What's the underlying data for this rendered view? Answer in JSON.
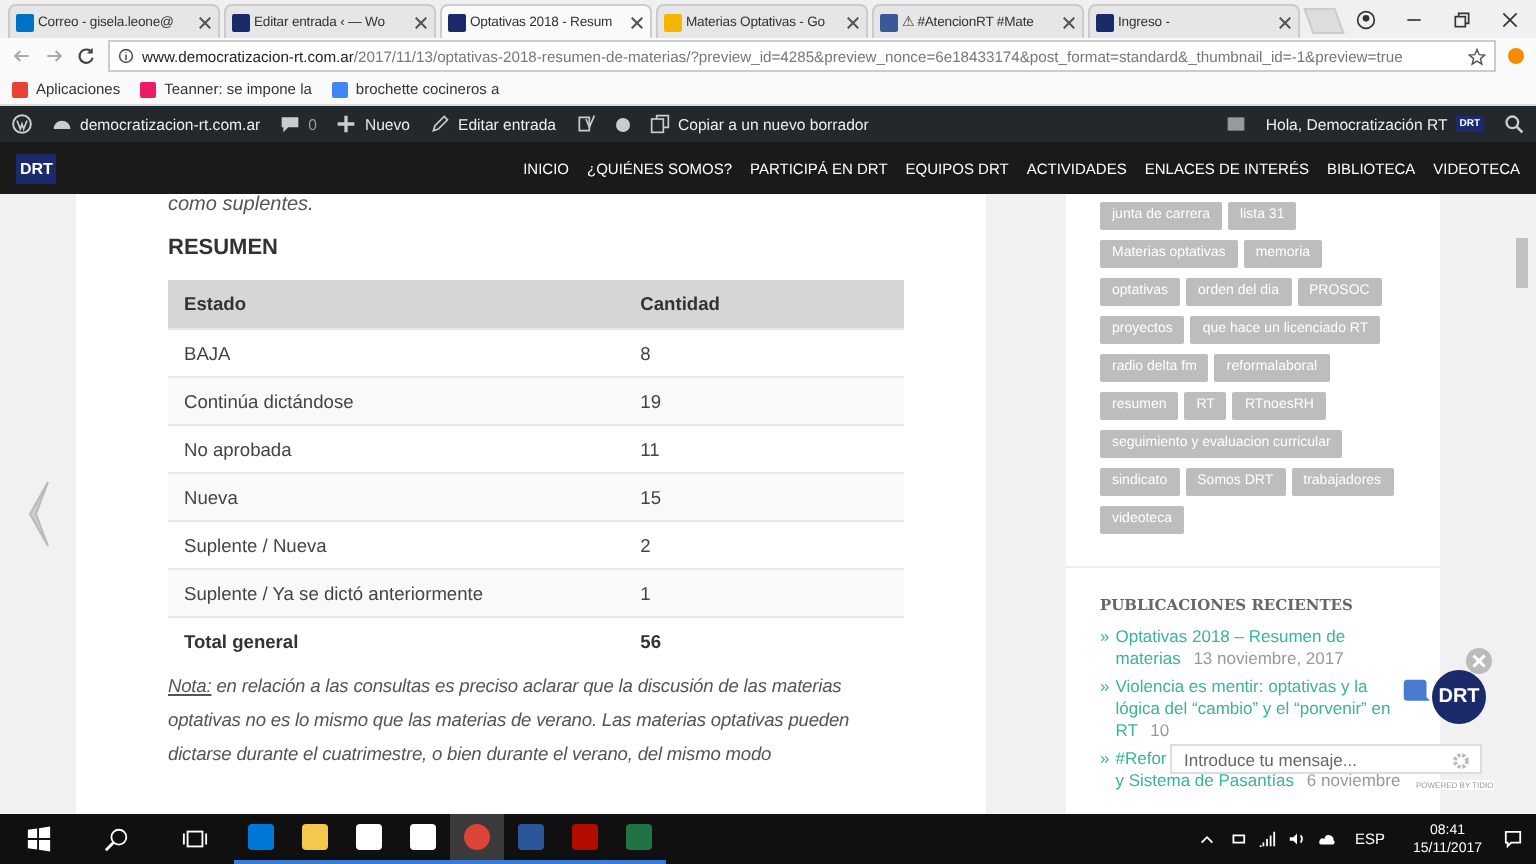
{
  "browser": {
    "tabs": [
      {
        "title": "Correo - gisela.leone@",
        "selected": false
      },
      {
        "title": "Editar entrada ‹ — Wo",
        "selected": false
      },
      {
        "title": "Optativas 2018 - Resum",
        "selected": true
      },
      {
        "title": "Materias Optativas - Go",
        "selected": false
      },
      {
        "title": "⚠ #AtencionRT #Mate",
        "selected": false
      },
      {
        "title": "Ingreso -",
        "selected": false
      }
    ],
    "address": {
      "domain": "www.democratizacion-rt.com.ar",
      "path": "/2017/11/13/optativas-2018-resumen-de-materias/?preview_id=4285&preview_nonce=6e18433174&post_format=standard&_thumbnail_id=-1&preview=true"
    },
    "bookmarks": [
      "Aplicaciones",
      "Teanner: se impone la",
      "brochette cocineros a"
    ]
  },
  "admin_bar": {
    "site": "democratizacion-rt.com.ar",
    "comments": "0",
    "new": "Nuevo",
    "edit": "Editar entrada",
    "copy": "Copiar a un nuevo borrador",
    "greeting": "Hola, Democratización RT",
    "avatar": "DRT"
  },
  "site_nav": {
    "logo": "DRT",
    "items": [
      "INICIO",
      "¿QUIÉNES SOMOS?",
      "PARTICIPÁ EN DRT",
      "EQUIPOS DRT",
      "ACTIVIDADES",
      "ENLACES DE INTERÉS",
      "BIBLIOTECA",
      "VIDEOTECA"
    ]
  },
  "article": {
    "intro": "como suplentes.",
    "heading": "RESUMEN",
    "table": {
      "columns": [
        "Estado",
        "Cantidad"
      ],
      "rows": [
        [
          "BAJA",
          "8"
        ],
        [
          "Continúa dictándose",
          "19"
        ],
        [
          "No aprobada",
          "11"
        ],
        [
          "Nueva",
          "15"
        ],
        [
          "Suplente / Nueva",
          "2"
        ],
        [
          "Suplente / Ya se dictó anteriormente",
          "1"
        ]
      ],
      "total": [
        "Total general",
        "56"
      ]
    },
    "note_label": "Nota:",
    "note_text": "en relación a las consultas es preciso aclarar que la discusión de las materias optativas no es lo mismo que las materias de verano. Las materias optativas pueden dictarse durante el cuatrimestre, o bien durante el verano, del mismo modo"
  },
  "sidebar": {
    "tags": [
      "junta de carrera",
      "lista 31",
      "Materias optativas",
      "memoria",
      "optativas",
      "orden del dia",
      "PROSOC",
      "proyectos",
      "que hace un licenciado RT",
      "radio delta fm",
      "reformalaboral",
      "resumen",
      "RT",
      "RTnoesRH",
      "seguimiento y evaluacion curricular",
      "sindicato",
      "Somos DRT",
      "trabajadores",
      "videoteca"
    ],
    "recent_title": "PUBLICACIONES RECIENTES",
    "posts": [
      {
        "bullet": "»",
        "title": "Optativas 2018 – Resumen de materias",
        "date": "13 noviembre, 2017"
      },
      {
        "bullet": "»",
        "title": "Violencia es mentir: optativas y la lógica del “cambio” y el “porvenir” en RT",
        "date": "10"
      },
      {
        "bullet": "»",
        "title": "#Refor",
        "continuation": "y Sistema de Pasantías",
        "date": "6 noviembre"
      }
    ]
  },
  "chat": {
    "avatar": "DRT",
    "placeholder": "Introduce tu mensaje...",
    "powered": "POWERED BY TIDIO"
  },
  "taskbar": {
    "apps": [
      {
        "kind": "edge",
        "selected": false
      },
      {
        "kind": "explorer",
        "selected": false
      },
      {
        "kind": "store",
        "selected": false
      },
      {
        "kind": "mail",
        "selected": false
      },
      {
        "kind": "chrome",
        "selected": true
      },
      {
        "kind": "word",
        "selected": false
      },
      {
        "kind": "acrobat",
        "selected": false
      },
      {
        "kind": "excel",
        "selected": false
      }
    ],
    "language": "ESP",
    "time": "08:41",
    "date": "15/11/2017"
  }
}
